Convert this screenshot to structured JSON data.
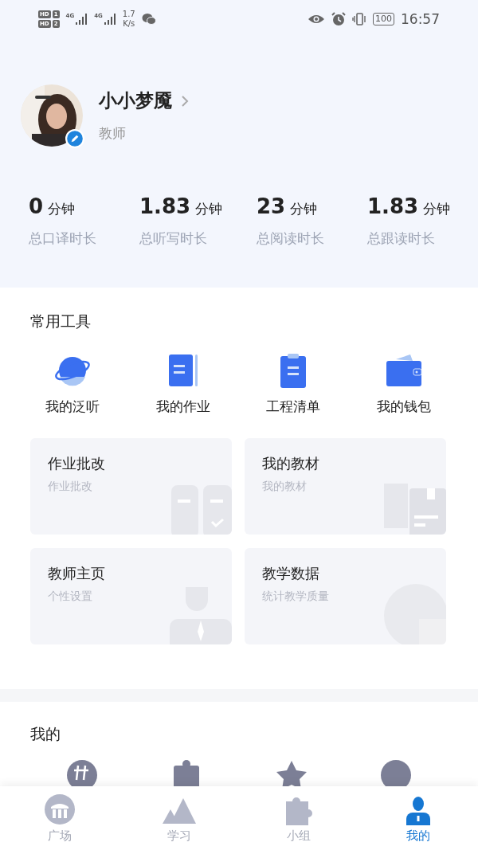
{
  "status_bar": {
    "sims": [
      "HD",
      "HD"
    ],
    "sim_numbers": [
      "1",
      "2"
    ],
    "networks": [
      "4G",
      "4G"
    ],
    "speed": "1.7",
    "speed_unit": "K/s",
    "battery": "100",
    "time": "16:57"
  },
  "profile": {
    "name": "小小梦魇",
    "role": "教师"
  },
  "stats": [
    {
      "value": "0",
      "unit": "分钟",
      "label": "总口译时长"
    },
    {
      "value": "1.83",
      "unit": "分钟",
      "label": "总听写时长"
    },
    {
      "value": "23",
      "unit": "分钟",
      "label": "总阅读时长"
    },
    {
      "value": "1.83",
      "unit": "分钟",
      "label": "总跟读时长"
    }
  ],
  "tools": {
    "title": "常用工具",
    "items": [
      {
        "kind": "planet",
        "label": "我的泛听"
      },
      {
        "kind": "notebook",
        "label": "我的作业"
      },
      {
        "kind": "clipboard",
        "label": "工程清单"
      },
      {
        "kind": "wallet",
        "label": "我的钱包"
      }
    ]
  },
  "cards": [
    {
      "kind": "grading",
      "title": "作业批改",
      "subtitle": "作业批改"
    },
    {
      "kind": "books",
      "title": "我的教材",
      "subtitle": "我的教材"
    },
    {
      "kind": "person",
      "title": "教师主页",
      "subtitle": "个性设置"
    },
    {
      "kind": "chart",
      "title": "教学数据",
      "subtitle": "统计教学质量"
    }
  ],
  "mine": {
    "title": "我的"
  },
  "tab_bar": [
    {
      "kind": "plaza",
      "label": "广场",
      "selected": false
    },
    {
      "kind": "mountain",
      "label": "学习",
      "selected": false
    },
    {
      "kind": "puzzle",
      "label": "小组",
      "selected": false
    },
    {
      "kind": "user",
      "label": "我的",
      "selected": true
    }
  ]
}
